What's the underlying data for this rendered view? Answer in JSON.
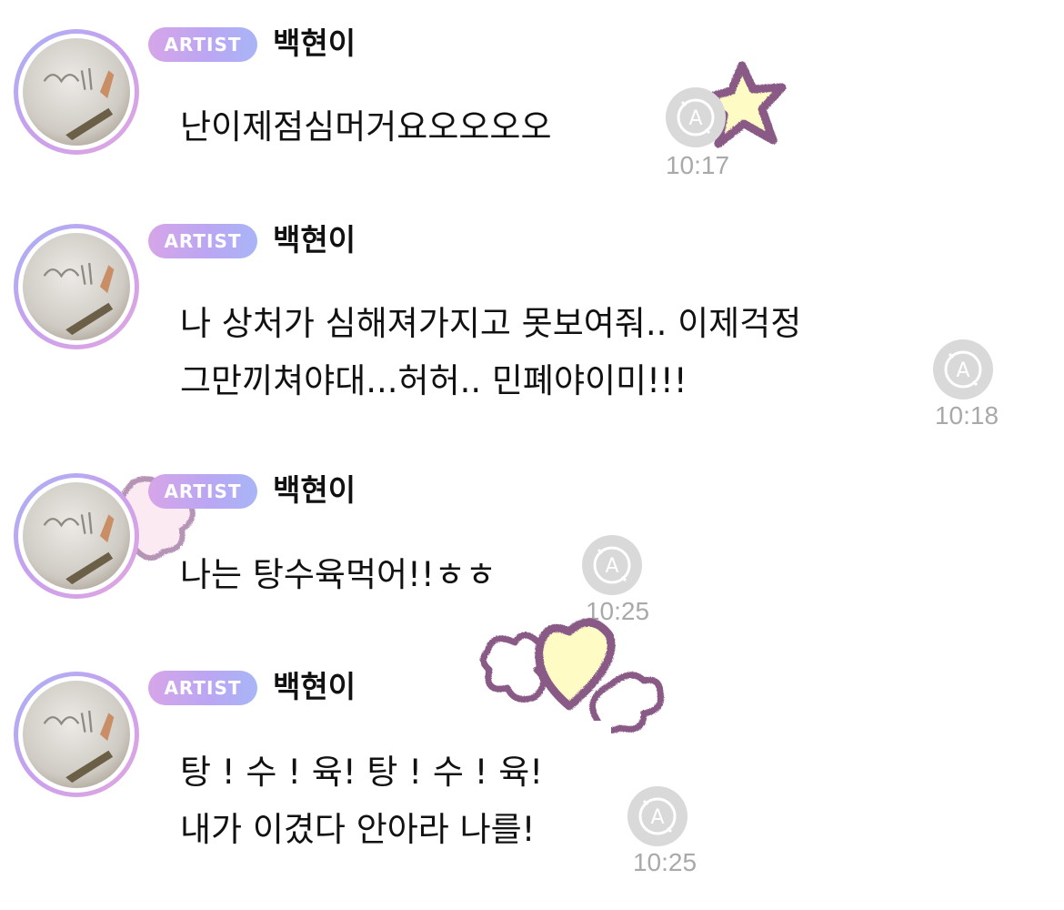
{
  "messages": [
    {
      "badge": "ARTIST",
      "sender": "백현이",
      "lines": [
        "난이제점심머거요오오오오"
      ],
      "time": "10:17",
      "read_icon": "auto-translate-icon"
    },
    {
      "badge": "ARTIST",
      "sender": "백현이",
      "lines": [
        "나 상처가 심해져가지고 못보여줘.. 이제걱정",
        "그만끼쳐야대...허허.. 민폐야이미!!!"
      ],
      "time": "10:18",
      "read_icon": "auto-translate-icon"
    },
    {
      "badge": "ARTIST",
      "sender": "백현이",
      "lines": [
        "나는 탕수육먹어!!ㅎㅎ"
      ],
      "time": "10:25",
      "read_icon": "auto-translate-icon"
    },
    {
      "badge": "ARTIST",
      "sender": "백현이",
      "lines": [
        "탕 ! 수 ! 육! 탕 ! 수 ! 육!",
        "내가 이겼다 안아라 나를!"
      ],
      "time": "10:25",
      "read_icon": "auto-translate-icon"
    }
  ],
  "colors": {
    "badge_gradient_start": "#d6a5e8",
    "badge_gradient_end": "#a8b5f6",
    "time_text": "#a9a9a9",
    "sticker_fill": "#fffbc4",
    "sticker_outline": "#8a5a86"
  }
}
